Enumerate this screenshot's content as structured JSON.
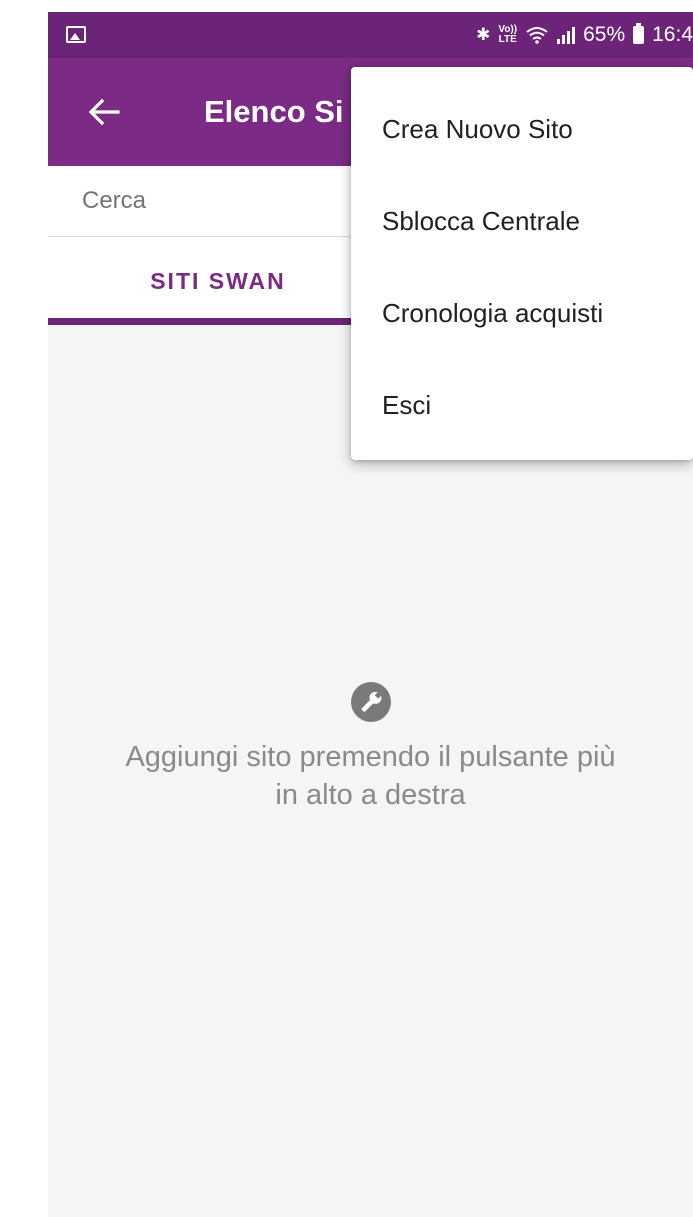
{
  "status_bar": {
    "bluetooth_icon": "bluetooth-icon",
    "volte_icon": "vo-lte-icon",
    "volte_top": "Vo))",
    "volte_bottom": "LTE",
    "wifi_icon": "wifi-icon",
    "signal_icon": "signal-bars-icon",
    "battery_percent": "65%",
    "battery_icon": "battery-icon",
    "time": "16:4"
  },
  "app_bar": {
    "back_icon": "arrow-back-icon",
    "title": "Elenco Si"
  },
  "search": {
    "placeholder": "Cerca"
  },
  "tabs": [
    {
      "label": "SITI SWAN",
      "selected": true
    }
  ],
  "empty_state": {
    "icon": "wrench-icon",
    "message": "Aggiungi sito premendo il pulsante più in alto a destra"
  },
  "menu": {
    "items": [
      {
        "label": "Crea Nuovo Sito"
      },
      {
        "label": "Sblocca Centrale"
      },
      {
        "label": "Cronologia acquisti"
      },
      {
        "label": "Esci"
      }
    ]
  },
  "colors": {
    "status_bar": "#6c2478",
    "app_bar": "#7b2b85",
    "accent": "#7b2b85",
    "background": "#f5f5f5"
  }
}
